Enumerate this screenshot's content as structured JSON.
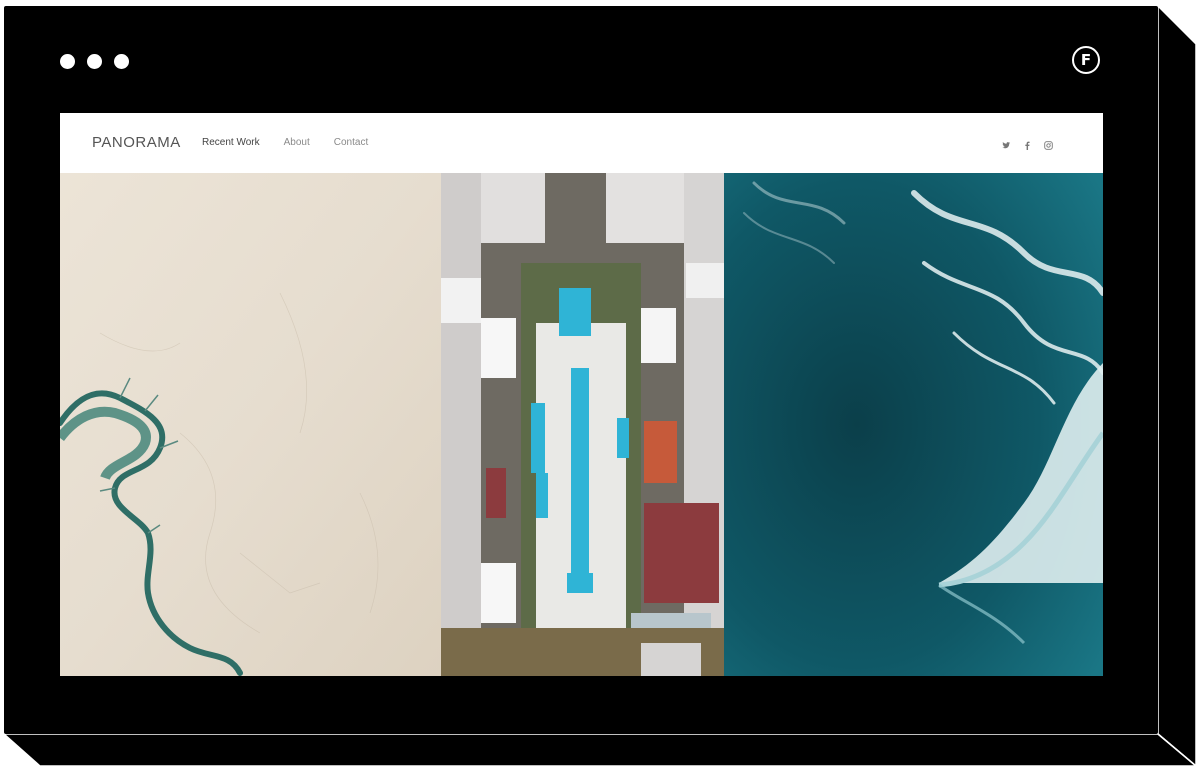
{
  "window": {
    "controls": [
      "dot",
      "dot",
      "dot"
    ],
    "badge_letter": "F"
  },
  "site": {
    "brand": "PANORAMA",
    "nav": [
      {
        "label": "Recent Work",
        "active": true
      },
      {
        "label": "About",
        "active": false
      },
      {
        "label": "Contact",
        "active": false
      }
    ],
    "social_icons": [
      "twitter-icon",
      "facebook-icon",
      "instagram-icon"
    ]
  },
  "gallery": {
    "panels": [
      {
        "name": "desert-river-photo",
        "colors": {
          "sand": "#e8dfd1",
          "water": "#2f6e66"
        }
      },
      {
        "name": "city-pool-aerial-photo",
        "colors": {
          "building": "#d9d7d6",
          "pool": "#2fb4d6",
          "court": "#c65a3a"
        }
      },
      {
        "name": "ocean-waves-photo",
        "colors": {
          "deep": "#0d4a57",
          "foam": "#e8f3f4"
        }
      }
    ]
  },
  "colors": {
    "frame": "#000000",
    "page_background": "#ffffff",
    "nav_text": "#8a8a8a",
    "brand_text": "#555555"
  }
}
